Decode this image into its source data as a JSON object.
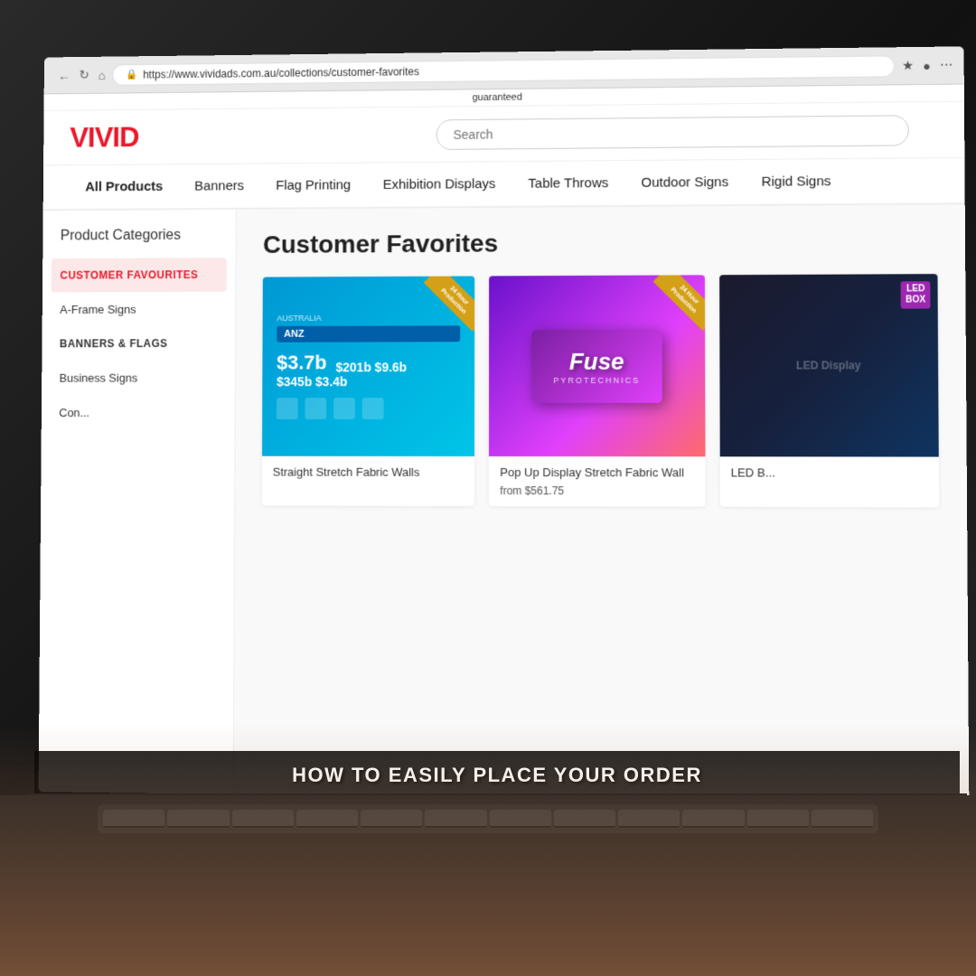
{
  "browser": {
    "url": "https://www.vividads.com.au/collections/customer-favorites",
    "url_display": "https://www.vividads.com.au/collections/customer-favorites",
    "search_placeholder": "Search"
  },
  "header": {
    "logo": "VIVID",
    "guarantee_text": "guaranteed"
  },
  "nav": {
    "items": [
      {
        "label": "All Products",
        "active": true
      },
      {
        "label": "Banners"
      },
      {
        "label": "Flag Printing"
      },
      {
        "label": "Exhibition Displays"
      },
      {
        "label": "Table Throws"
      },
      {
        "label": "Outdoor Signs"
      },
      {
        "label": "Rigid Signs"
      }
    ]
  },
  "sidebar": {
    "title": "Product Categories",
    "items": [
      {
        "label": "CUSTOMER FAVOURITES",
        "active": true
      },
      {
        "label": "A-Frame Signs"
      },
      {
        "label": "BANNERS & FLAGS",
        "bold": true
      },
      {
        "label": "Business Signs"
      },
      {
        "label": "Con..."
      }
    ]
  },
  "main": {
    "page_title": "Customer Favorites",
    "products": [
      {
        "name": "Straight Stretch Fabric Walls",
        "price": "",
        "ribbon": "24 Hour Production",
        "type": "anz"
      },
      {
        "name": "Pop Up Display Stretch Fabric Wall",
        "price": "from $561.75",
        "ribbon": "24 Hour Production",
        "type": "fuse"
      },
      {
        "name": "LED B...",
        "price": "",
        "ribbon": "",
        "type": "led",
        "badge": "LED BOX"
      }
    ]
  },
  "caption": {
    "text": "HOW TO EASILY PLACE YOUR ORDER"
  },
  "anz_product": {
    "logo": "ANZ",
    "stats": [
      {
        "value": "$3.7b",
        "label": ""
      },
      {
        "value": "$201b",
        "label": ""
      },
      {
        "value": "$9.6b",
        "label": ""
      },
      {
        "value": "$345b",
        "label": ""
      },
      {
        "value": "$3.4b",
        "label": ""
      }
    ]
  },
  "fuse_product": {
    "title": "Fuse",
    "subtitle": "PYROTECHNICS"
  }
}
